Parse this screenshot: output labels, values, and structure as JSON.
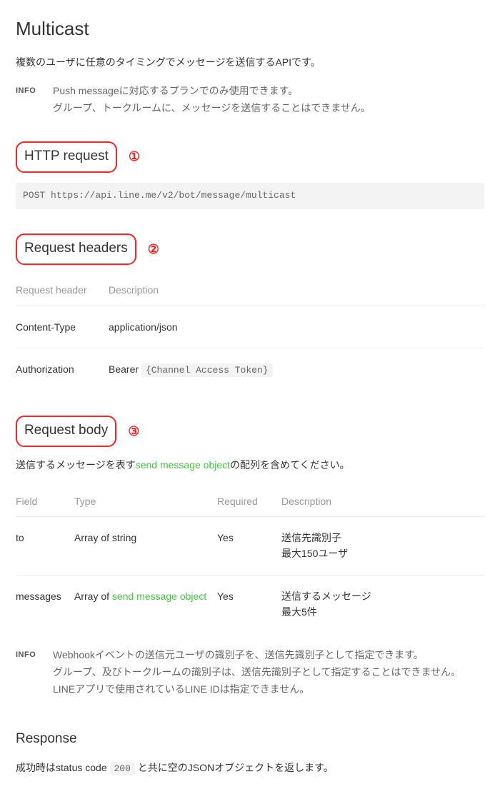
{
  "title": "Multicast",
  "description": "複数のユーザに任意のタイミングでメッセージを送信するAPIです。",
  "info_top": {
    "label": "INFO",
    "line1": "Push messageに対応するプランでのみ使用できます。",
    "line2": "グループ、トークルームに、メッセージを送信することはできません。"
  },
  "http_request": {
    "heading": "HTTP request",
    "number": "①",
    "code": "POST https://api.line.me/v2/bot/message/multicast"
  },
  "request_headers": {
    "heading": "Request headers",
    "number": "②",
    "columns": {
      "c0": "Request header",
      "c1": "Description"
    },
    "rows": [
      {
        "header": "Content-Type",
        "desc_plain": "application/json"
      },
      {
        "header": "Authorization",
        "desc_prefix": "Bearer ",
        "desc_code": "{Channel Access Token}"
      }
    ]
  },
  "request_body": {
    "heading": "Request body",
    "number": "③",
    "intro_pre": "送信するメッセージを表す",
    "intro_link": "send message object",
    "intro_post": "の配列を含めてください。",
    "columns": {
      "c0": "Field",
      "c1": "Type",
      "c2": "Required",
      "c3": "Description"
    },
    "rows": [
      {
        "field": "to",
        "type_plain": "Array of string",
        "required": "Yes",
        "desc": "送信先識別子\n最大150ユーザ"
      },
      {
        "field": "messages",
        "type_pre": "Array of ",
        "type_link": "send message object",
        "required": "Yes",
        "desc": "送信するメッセージ\n最大5件"
      }
    ]
  },
  "info_bottom": {
    "label": "INFO",
    "line1": "Webhookイベントの送信元ユーザの識別子を、送信先識別子として指定できます。",
    "line2": "グループ、及びトークルームの識別子は、送信先識別子として指定することはできません。",
    "line3": "LINEアプリで使用されているLINE IDは指定できません。"
  },
  "response": {
    "heading": "Response",
    "text_pre": "成功時はstatus code ",
    "code": "200",
    "text_post": " と共に空のJSONオブジェクトを返します。"
  }
}
